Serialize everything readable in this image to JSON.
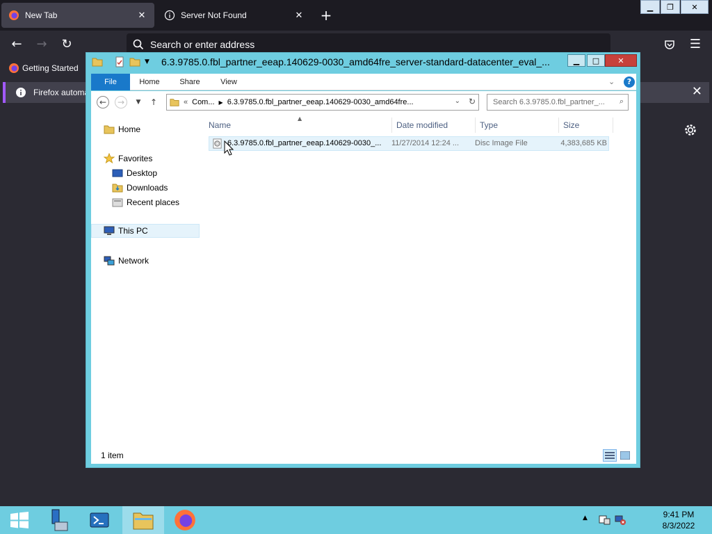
{
  "browser": {
    "tabs": [
      {
        "label": "New Tab",
        "active": true
      },
      {
        "label": "Server Not Found",
        "active": false
      }
    ],
    "url_placeholder": "Search or enter address",
    "bookmark": "Getting Started",
    "notification": "Firefox automa"
  },
  "explorer": {
    "title": "6.3.9785.0.fbl_partner_eeap.140629-0030_amd64fre_server-standard-datacenter_eval_...",
    "ribbon_tabs": [
      "File",
      "Home",
      "Share",
      "View"
    ],
    "address_root": "Com...",
    "address_folder": "6.3.9785.0.fbl_partner_eeap.140629-0030_amd64fre...",
    "search_placeholder": "Search 6.3.9785.0.fbl_partner_...",
    "nav": {
      "home": "Home",
      "favorites": "Favorites",
      "desktop": "Desktop",
      "downloads": "Downloads",
      "recent": "Recent places",
      "this_pc": "This PC",
      "network": "Network"
    },
    "columns": {
      "name": "Name",
      "date": "Date modified",
      "type": "Type",
      "size": "Size"
    },
    "files": [
      {
        "name": "6.3.9785.0.fbl_partner_eeap.140629-0030_...",
        "date": "11/27/2014 12:24 ...",
        "type": "Disc Image File",
        "size": "4,383,685 KB"
      }
    ],
    "status": "1 item"
  },
  "taskbar": {
    "time": "9:41 PM",
    "date": "8/3/2022"
  },
  "colors": {
    "accent": "#1979ca",
    "taskbar": "#6ecde0",
    "firefox_dark": "#1c1b22",
    "selection": "#e5f3fb"
  }
}
